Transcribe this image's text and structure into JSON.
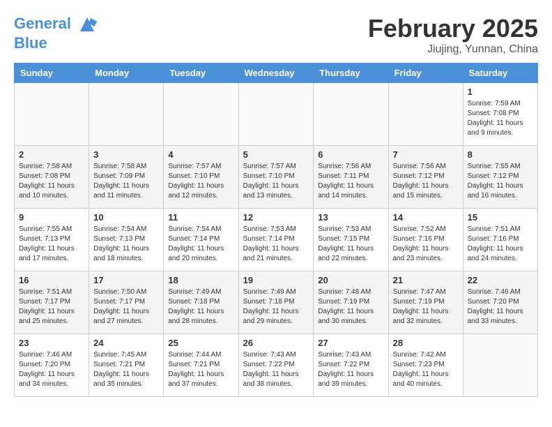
{
  "header": {
    "logo_line1": "General",
    "logo_line2": "Blue",
    "month": "February 2025",
    "location": "Jiujing, Yunnan, China"
  },
  "weekdays": [
    "Sunday",
    "Monday",
    "Tuesday",
    "Wednesday",
    "Thursday",
    "Friday",
    "Saturday"
  ],
  "weeks": [
    [
      {
        "day": "",
        "detail": ""
      },
      {
        "day": "",
        "detail": ""
      },
      {
        "day": "",
        "detail": ""
      },
      {
        "day": "",
        "detail": ""
      },
      {
        "day": "",
        "detail": ""
      },
      {
        "day": "",
        "detail": ""
      },
      {
        "day": "1",
        "detail": "Sunrise: 7:59 AM\nSunset: 7:08 PM\nDaylight: 11 hours\nand 9 minutes."
      }
    ],
    [
      {
        "day": "2",
        "detail": "Sunrise: 7:58 AM\nSunset: 7:08 PM\nDaylight: 11 hours\nand 10 minutes."
      },
      {
        "day": "3",
        "detail": "Sunrise: 7:58 AM\nSunset: 7:09 PM\nDaylight: 11 hours\nand 11 minutes."
      },
      {
        "day": "4",
        "detail": "Sunrise: 7:57 AM\nSunset: 7:10 PM\nDaylight: 11 hours\nand 12 minutes."
      },
      {
        "day": "5",
        "detail": "Sunrise: 7:57 AM\nSunset: 7:10 PM\nDaylight: 11 hours\nand 13 minutes."
      },
      {
        "day": "6",
        "detail": "Sunrise: 7:56 AM\nSunset: 7:11 PM\nDaylight: 11 hours\nand 14 minutes."
      },
      {
        "day": "7",
        "detail": "Sunrise: 7:56 AM\nSunset: 7:12 PM\nDaylight: 11 hours\nand 15 minutes."
      },
      {
        "day": "8",
        "detail": "Sunrise: 7:55 AM\nSunset: 7:12 PM\nDaylight: 11 hours\nand 16 minutes."
      }
    ],
    [
      {
        "day": "9",
        "detail": "Sunrise: 7:55 AM\nSunset: 7:13 PM\nDaylight: 11 hours\nand 17 minutes."
      },
      {
        "day": "10",
        "detail": "Sunrise: 7:54 AM\nSunset: 7:13 PM\nDaylight: 11 hours\nand 18 minutes."
      },
      {
        "day": "11",
        "detail": "Sunrise: 7:54 AM\nSunset: 7:14 PM\nDaylight: 11 hours\nand 20 minutes."
      },
      {
        "day": "12",
        "detail": "Sunrise: 7:53 AM\nSunset: 7:14 PM\nDaylight: 11 hours\nand 21 minutes."
      },
      {
        "day": "13",
        "detail": "Sunrise: 7:53 AM\nSunset: 7:15 PM\nDaylight: 11 hours\nand 22 minutes."
      },
      {
        "day": "14",
        "detail": "Sunrise: 7:52 AM\nSunset: 7:16 PM\nDaylight: 11 hours\nand 23 minutes."
      },
      {
        "day": "15",
        "detail": "Sunrise: 7:51 AM\nSunset: 7:16 PM\nDaylight: 11 hours\nand 24 minutes."
      }
    ],
    [
      {
        "day": "16",
        "detail": "Sunrise: 7:51 AM\nSunset: 7:17 PM\nDaylight: 11 hours\nand 25 minutes."
      },
      {
        "day": "17",
        "detail": "Sunrise: 7:50 AM\nSunset: 7:17 PM\nDaylight: 11 hours\nand 27 minutes."
      },
      {
        "day": "18",
        "detail": "Sunrise: 7:49 AM\nSunset: 7:18 PM\nDaylight: 11 hours\nand 28 minutes."
      },
      {
        "day": "19",
        "detail": "Sunrise: 7:49 AM\nSunset: 7:18 PM\nDaylight: 11 hours\nand 29 minutes."
      },
      {
        "day": "20",
        "detail": "Sunrise: 7:48 AM\nSunset: 7:19 PM\nDaylight: 11 hours\nand 30 minutes."
      },
      {
        "day": "21",
        "detail": "Sunrise: 7:47 AM\nSunset: 7:19 PM\nDaylight: 11 hours\nand 32 minutes."
      },
      {
        "day": "22",
        "detail": "Sunrise: 7:46 AM\nSunset: 7:20 PM\nDaylight: 11 hours\nand 33 minutes."
      }
    ],
    [
      {
        "day": "23",
        "detail": "Sunrise: 7:46 AM\nSunset: 7:20 PM\nDaylight: 11 hours\nand 34 minutes."
      },
      {
        "day": "24",
        "detail": "Sunrise: 7:45 AM\nSunset: 7:21 PM\nDaylight: 11 hours\nand 35 minutes."
      },
      {
        "day": "25",
        "detail": "Sunrise: 7:44 AM\nSunset: 7:21 PM\nDaylight: 11 hours\nand 37 minutes."
      },
      {
        "day": "26",
        "detail": "Sunrise: 7:43 AM\nSunset: 7:22 PM\nDaylight: 11 hours\nand 38 minutes."
      },
      {
        "day": "27",
        "detail": "Sunrise: 7:43 AM\nSunset: 7:22 PM\nDaylight: 11 hours\nand 39 minutes."
      },
      {
        "day": "28",
        "detail": "Sunrise: 7:42 AM\nSunset: 7:23 PM\nDaylight: 11 hours\nand 40 minutes."
      },
      {
        "day": "",
        "detail": ""
      }
    ]
  ]
}
